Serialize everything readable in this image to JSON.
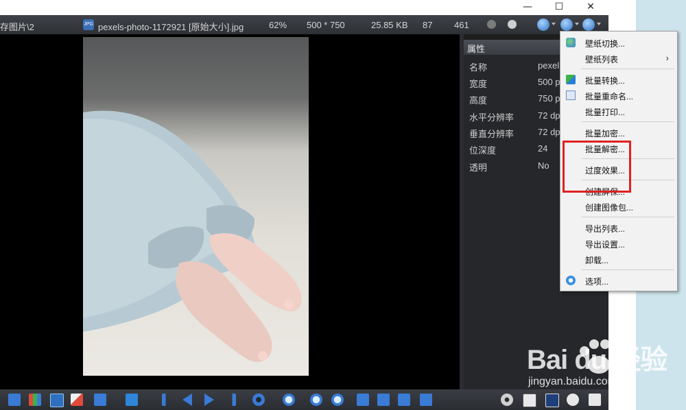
{
  "window": {
    "minimize_glyph": "—",
    "maximize_glyph": "☐",
    "close_glyph": "✕"
  },
  "infobar": {
    "path": "存图片\\2",
    "file_name": "pexels-photo-1172921 [原始大小].jpg",
    "zoom": "62%",
    "dimensions": "500 * 750",
    "file_size": "25.85 KB",
    "num_a": "87",
    "num_b": "461",
    "dot_colors": [
      "#7c7c7c",
      "#cfcfcf"
    ]
  },
  "properties": {
    "header": "属性",
    "rows": [
      {
        "key": "名称",
        "value": "pexel"
      },
      {
        "key": "宽度",
        "value": "500 p"
      },
      {
        "key": "高度",
        "value": "750 p"
      },
      {
        "key": "水平分辨率",
        "value": "72 dp"
      },
      {
        "key": "垂直分辨率",
        "value": "72 dp"
      },
      {
        "key": "位深度",
        "value": "24"
      },
      {
        "key": "透明",
        "value": "No"
      }
    ]
  },
  "menu": {
    "items": [
      {
        "label": "壁纸切换...",
        "icon": "wallpaper-icon"
      },
      {
        "label": "壁纸列表",
        "submenu_glyph": "›"
      },
      {
        "label": "批量转换...",
        "icon": "batch-convert-icon"
      },
      {
        "label": "批量重命名...",
        "icon": "batch-rename-icon"
      },
      {
        "label": "批量打印..."
      },
      {
        "label": "批量加密..."
      },
      {
        "label": "批量解密..."
      },
      {
        "label": "过度效果..."
      },
      {
        "label": "创建屏保..."
      },
      {
        "label": "创建图像包..."
      },
      {
        "label": "导出列表..."
      },
      {
        "label": "导出设置..."
      },
      {
        "label": "卸载..."
      },
      {
        "label": "选项...",
        "icon": "options-icon"
      }
    ]
  },
  "watermark": {
    "brand": "Bai  du 经验",
    "url": "jingyan.baidu.com"
  },
  "colors": {
    "accent_blue": "#2f6fbf",
    "highlight_red": "#e02020"
  }
}
